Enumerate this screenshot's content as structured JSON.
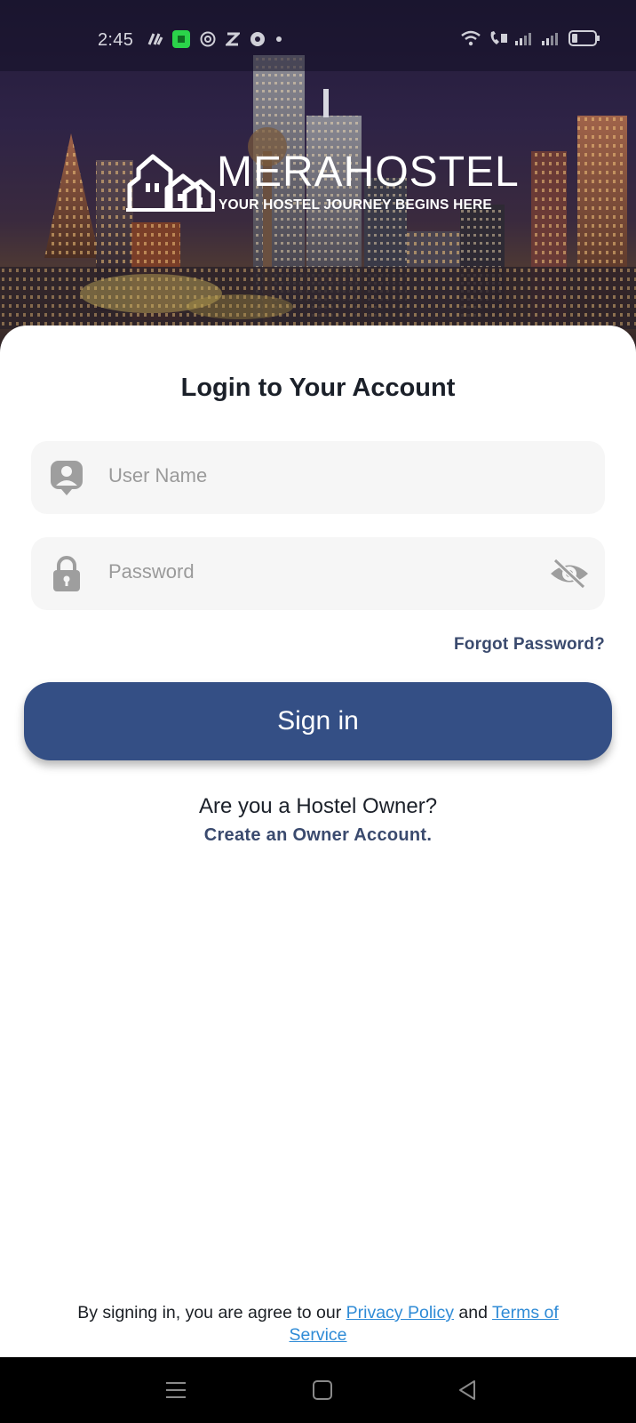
{
  "status_bar": {
    "time": "2:45",
    "left_icons": [
      "sim-activity-icon",
      "app-notification-icon",
      "openai-icon",
      "z-icon",
      "shield-icon",
      "dot-icon"
    ],
    "right_icons": [
      "wifi-icon",
      "volte-call-icon",
      "signal-icon",
      "signal-icon",
      "battery-icon"
    ]
  },
  "brand": {
    "title": "MERAHOSTEL",
    "tagline": "YOUR HOSTEL JOURNEY BEGINS HERE"
  },
  "login": {
    "title": "Login to Your Account",
    "username_placeholder": "User Name",
    "password_placeholder": "Password",
    "forgot_label": "Forgot Password?",
    "signin_label": "Sign in"
  },
  "owner": {
    "question": "Are you a Hostel Owner?",
    "link_label": "Create an Owner Account."
  },
  "legal": {
    "prefix": "By signing in, you are agree to our ",
    "privacy_label": "Privacy Policy",
    "middle": " and ",
    "terms_label": "Terms of Service"
  },
  "colors": {
    "primary": "#344f85",
    "link": "#3a4a6e",
    "legal_link": "#2f8bd6",
    "field_bg": "#f6f6f6",
    "icon_gray": "#9e9e9e"
  },
  "nav": {
    "icons": [
      "menu-icon",
      "home-icon",
      "back-icon"
    ]
  }
}
